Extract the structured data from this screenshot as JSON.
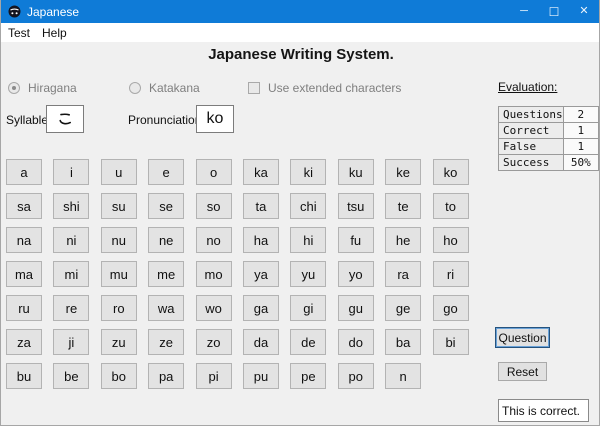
{
  "window": {
    "title": "Japanese",
    "controls": {
      "minimize": "─",
      "maximize": "☐",
      "close": "✕"
    }
  },
  "menu": {
    "items": [
      "Test",
      "Help"
    ]
  },
  "heading": "Japanese Writing System.",
  "options": {
    "radios": [
      {
        "label": "Hiragana",
        "selected": true
      },
      {
        "label": "Katakana",
        "selected": false
      }
    ],
    "checkbox": {
      "label": "Use extended characters",
      "checked": false
    }
  },
  "current": {
    "syllable_label": "Syllable",
    "syllable_value": "こ",
    "pronunciation_label": "Pronunciation",
    "pronunciation_value": "ko"
  },
  "evaluation": {
    "title": "Evaluation:",
    "rows": [
      [
        "Questions",
        "2"
      ],
      [
        "Correct",
        "1"
      ],
      [
        "False",
        "1"
      ],
      [
        "Success",
        "50%"
      ]
    ]
  },
  "grid": {
    "rows": [
      [
        "a",
        "i",
        "u",
        "e",
        "o",
        "ka",
        "ki",
        "ku",
        "ke",
        "ko"
      ],
      [
        "sa",
        "shi",
        "su",
        "se",
        "so",
        "ta",
        "chi",
        "tsu",
        "te",
        "to"
      ],
      [
        "na",
        "ni",
        "nu",
        "ne",
        "no",
        "ha",
        "hi",
        "fu",
        "he",
        "ho"
      ],
      [
        "ma",
        "mi",
        "mu",
        "me",
        "mo",
        "ya",
        "yu",
        "yo",
        "ra",
        "ri"
      ],
      [
        "ru",
        "re",
        "ro",
        "wa",
        "wo",
        "ga",
        "gi",
        "gu",
        "ge",
        "go"
      ],
      [
        "za",
        "ji",
        "zu",
        "ze",
        "zo",
        "da",
        "de",
        "do",
        "ba",
        "bi"
      ],
      [
        "bu",
        "be",
        "bo",
        "pa",
        "pi",
        "pu",
        "pe",
        "po",
        "n"
      ]
    ]
  },
  "actions": {
    "question": "Question",
    "reset": "Reset"
  },
  "result": {
    "text": "This is correct."
  },
  "colors": {
    "titlebar": "#0f7bd7",
    "background": "#f0f0f0",
    "accent": "#0078d7",
    "disabled_text": "#7f7f7f",
    "button_face": "#e3e3e3"
  }
}
